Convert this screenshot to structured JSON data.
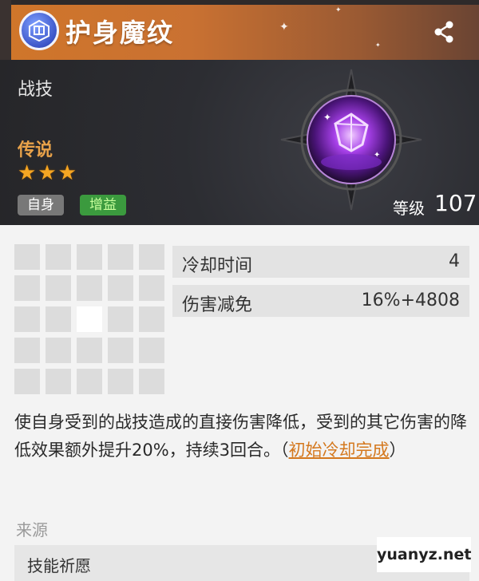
{
  "header": {
    "title": "护身魔纹",
    "emblem_icon": "skill-book-emblem-icon",
    "share_icon": "share-icon"
  },
  "skill": {
    "type": "战技",
    "rarity": "传说",
    "stars": 3,
    "tags": [
      "自身",
      "增益"
    ],
    "level_label": "等级",
    "level_value": "107",
    "icon": "purple-magic-seal-icon"
  },
  "stats": [
    {
      "label": "冷却时间",
      "value": "4"
    },
    {
      "label": "伤害减免",
      "value": "16%+4808"
    }
  ],
  "range_grid": {
    "rows": 5,
    "cols": 5,
    "active_cell": [
      2,
      2
    ]
  },
  "description": {
    "main": "使自身受到的战技造成的直接伤害降低，受到的其它伤害的降低效果额外提升20%，持续3回合。（",
    "highlight": "初始冷却完成",
    "tail": "）"
  },
  "source": {
    "label": "来源",
    "value": "技能祈愿"
  },
  "watermark": "yuanyz.net",
  "colors": {
    "header_orange": "#d0762a",
    "rarity_orange": "#e8a24a",
    "star_gold": "#f5a623",
    "tag_gray": "#787878",
    "tag_green": "#3b9a3e",
    "highlight_orange": "#d4781e"
  }
}
